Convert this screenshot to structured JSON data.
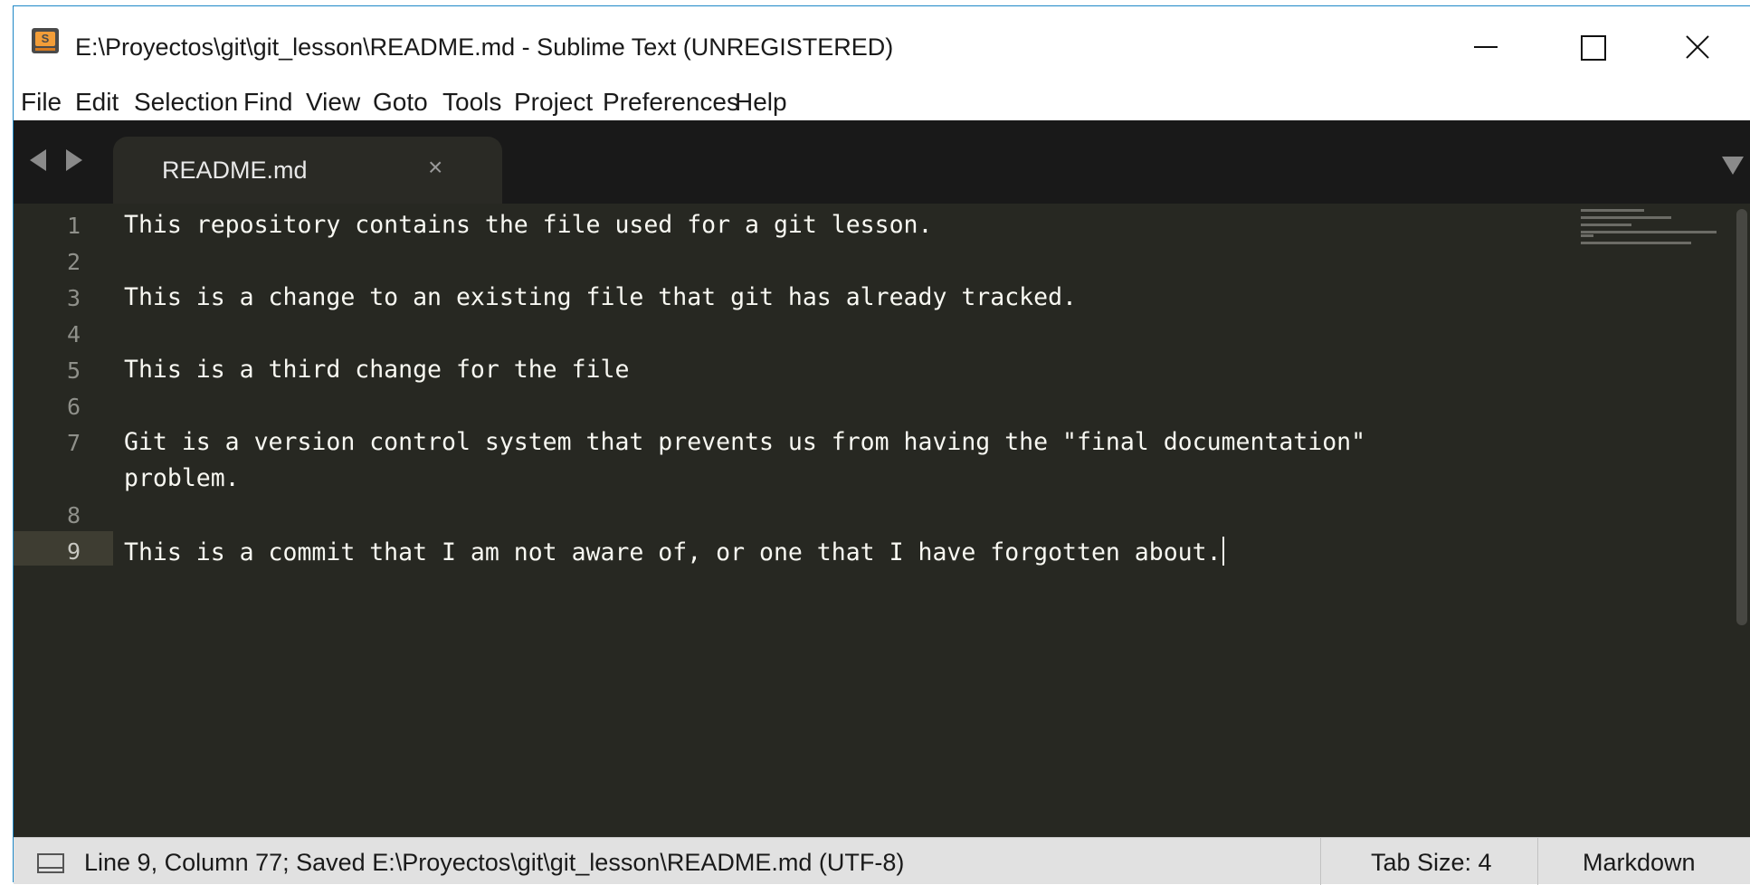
{
  "window": {
    "title": "E:\\Proyectos\\git\\git_lesson\\README.md - Sublime Text (UNREGISTERED)"
  },
  "menu": {
    "items": [
      "File",
      "Edit",
      "Selection",
      "Find",
      "View",
      "Goto",
      "Tools",
      "Project",
      "Preferences",
      "Help"
    ]
  },
  "tabs": [
    {
      "label": "README.md",
      "close_glyph": "×",
      "active": true
    }
  ],
  "editor": {
    "line_numbers": [
      "1",
      "2",
      "3",
      "4",
      "5",
      "6",
      "7",
      "8",
      "9"
    ],
    "lines": [
      "This repository contains the file used for a git lesson.",
      "",
      "This is a change to an existing file that git has already tracked.",
      "",
      "This is a third change for the file",
      "",
      "Git is a version control system that prevents us from having the \"final documentation\"",
      "problem.",
      "",
      "This is a commit that I am not aware of, or one that I have forgotten about."
    ],
    "active_line": "9"
  },
  "status": {
    "message": "Line 9, Column 77; Saved E:\\Proyectos\\git\\git_lesson\\README.md (UTF-8)",
    "tab_size": "Tab Size: 4",
    "syntax": "Markdown"
  },
  "colors": {
    "editor_bg": "#272822",
    "editor_fg": "#f8f8f2",
    "tabbar_bg": "#191919",
    "statusbar_bg": "#e1e1e1",
    "window_border": "#1e88c7"
  }
}
